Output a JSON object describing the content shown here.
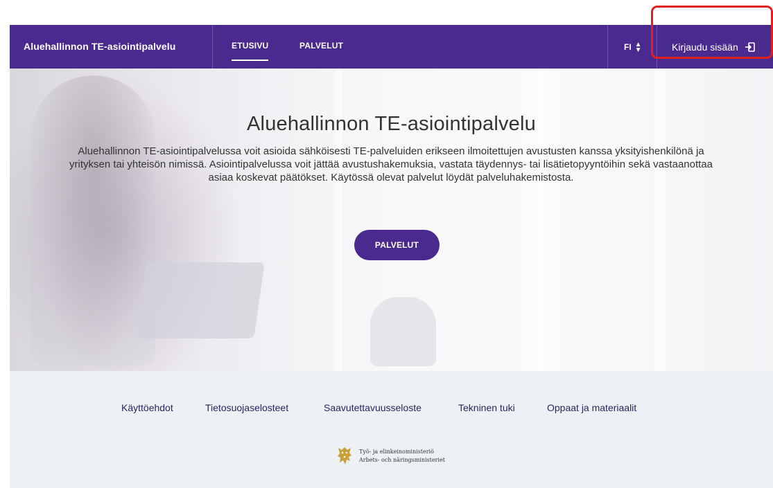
{
  "nav": {
    "brand": "Aluehallinnon TE-asiointipalvelu",
    "links": [
      {
        "label": "ETUSIVU",
        "active": true
      },
      {
        "label": "PALVELUT",
        "active": false
      }
    ],
    "language": "FI",
    "login_label": "Kirjaudu sisään",
    "background_color": "#4a2a8e"
  },
  "hero": {
    "title": "Aluehallinnon TE-asiointipalvelu",
    "description": "Aluehallinnon TE-asiointipalvelussa voit asioida sähköisesti TE-palveluiden erikseen ilmoitettujen avustusten kanssa yksityishenkilönä ja yrityksen tai yhteisön nimissä. Asiointipalvelussa voit jättää avustushakemuksia, vastata täydennys- tai lisätietopyyntöihin sekä vastaanottaa asiaa koskevat päätökset. Käytössä olevat palvelut löydät palveluhakemistosta.",
    "button_label": "PALVELUT"
  },
  "footer": {
    "links": [
      "Käyttöehdot",
      "Tietosuojaselosteet",
      "Saavutettavuusseloste",
      "Tekninen tuki",
      "Oppaat ja materiaalit"
    ],
    "ministry": {
      "line1": "Työ- ja elinkeinoministeriö",
      "line2": "Arbets- och näringsministeriet"
    }
  },
  "highlight_color": "#e0201e"
}
